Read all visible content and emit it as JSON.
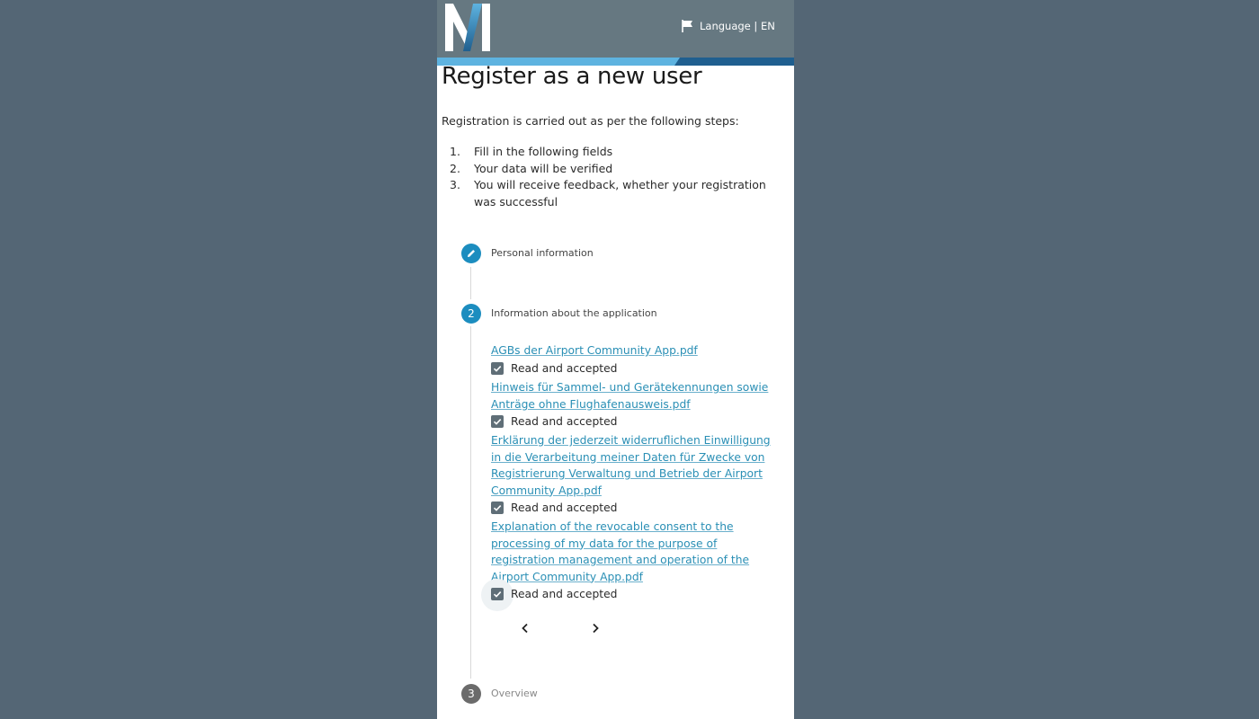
{
  "header": {
    "language_label": "Language | EN",
    "colors": {
      "bar": "#667881",
      "stripe_light": "#5eb3e0",
      "stripe_dark": "#1f5f8f"
    }
  },
  "page": {
    "title": "Register as a new user",
    "intro": "Registration is carried out as per the following steps:",
    "steps": [
      {
        "num": "1.",
        "text": "Fill in the following fields"
      },
      {
        "num": "2.",
        "text": "Your data will be verified"
      },
      {
        "num": "3.",
        "text": "You will receive feedback, whether your registration was successful"
      }
    ]
  },
  "stepper": {
    "step1": {
      "label": "Personal information",
      "icon": "pencil-icon",
      "color": "#1c8dbf"
    },
    "step2": {
      "number": "2",
      "label": "Information about the application",
      "color": "#1c8dbf"
    },
    "step3": {
      "number": "3",
      "label": "Overview",
      "color": "#6b6b6b"
    }
  },
  "documents": [
    {
      "link": "AGBs der Airport Community App.pdf",
      "check_label": "Read and accepted",
      "checked": true
    },
    {
      "link": "Hinweis für Sammel- und Gerätekennungen sowie Anträge ohne Flughafenausweis.pdf",
      "check_label": "Read and accepted",
      "checked": true
    },
    {
      "link": "Erklärung der jederzeit widerruflichen Einwilligung in die Verarbeitung meiner Daten für Zwecke von Registrierung Verwaltung und Betrieb der Airport Community App.pdf",
      "check_label": "Read and accepted",
      "checked": true
    },
    {
      "link": "Explanation of the revocable consent to the processing of my data for the purpose of registration management and operation of the Airport Community App.pdf",
      "check_label": "Read and accepted",
      "checked": true
    }
  ],
  "nav": {
    "prev_icon": "chevron-left-icon",
    "next_icon": "chevron-right-icon"
  }
}
